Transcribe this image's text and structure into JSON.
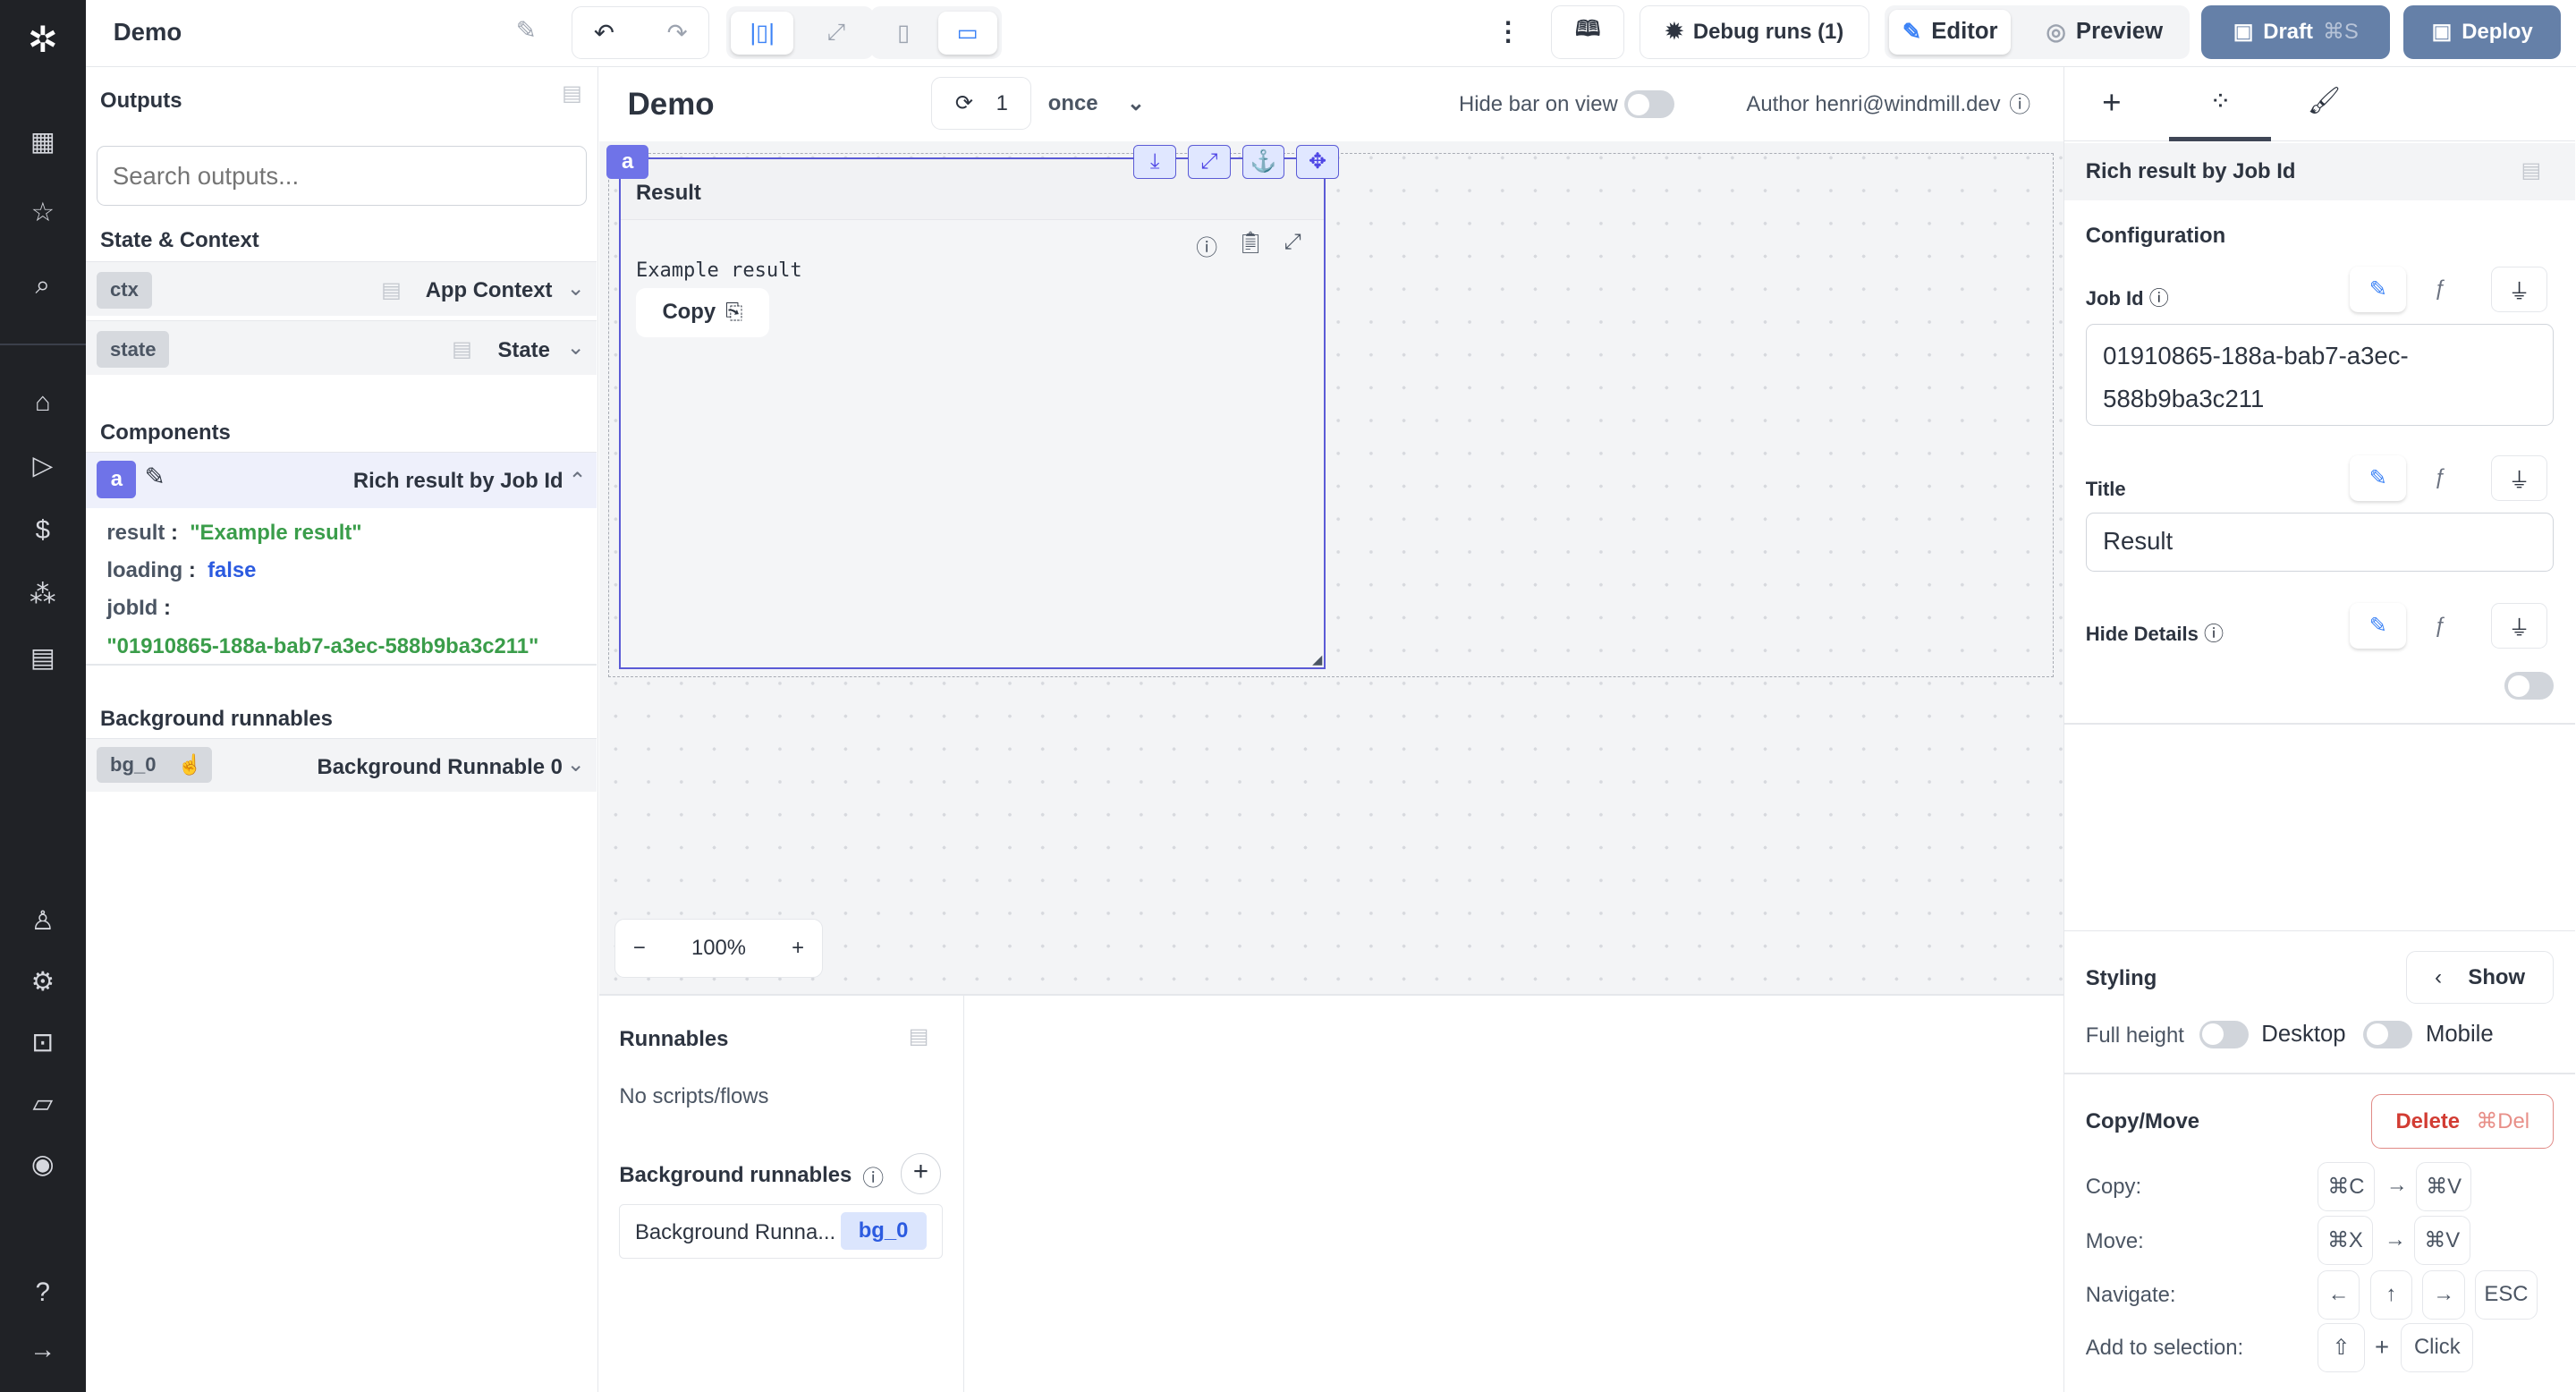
{
  "app": {
    "title": "Demo"
  },
  "toolbar": {
    "debug_runs": "Debug runs (1)",
    "editor": "Editor",
    "preview": "Preview",
    "draft": "Draft",
    "draft_shortcut": "⌘S",
    "deploy": "Deploy",
    "accent": "#3b82f6",
    "primary_bg": "#6580a8"
  },
  "outputs": {
    "title": "Outputs",
    "search_placeholder": "Search outputs...",
    "state_title": "State & Context",
    "ctx_tag": "ctx",
    "ctx_label": "App Context",
    "state_tag": "state",
    "state_label": "State",
    "components_title": "Components",
    "component_id": "a",
    "component_label": "Rich result by Job Id",
    "fields": [
      {
        "key": "result",
        "value": "\"Example result\""
      },
      {
        "key": "loading",
        "value": "false"
      },
      {
        "key": "jobId",
        "value": "\"01910865-188a-bab7-a3ec-588b9ba3c211\""
      }
    ],
    "bg_title": "Background runnables",
    "bg_tag": "bg_0",
    "bg_label": "Background Runnable 0"
  },
  "canvas": {
    "title": "Demo",
    "refresh_count": "1",
    "refresh_mode": "once",
    "hide_bar": "Hide bar on view",
    "author": "Author henri@windmill.dev",
    "component": {
      "id": "a",
      "header": "Result",
      "content": "Example result",
      "copy": "Copy"
    },
    "zoom": "100%"
  },
  "runnables": {
    "title": "Runnables",
    "empty": "No scripts/flows",
    "bg_title": "Background runnables",
    "bg_item": "Background Runna...",
    "bg_item_tag": "bg_0"
  },
  "settings": {
    "title": "Rich result by Job Id",
    "config": "Configuration",
    "job_id_label": "Job Id",
    "job_id_value": "01910865-188a-bab7-a3ec-588b9ba3c211",
    "title_label": "Title",
    "title_value": "Result",
    "hide_details": "Hide Details",
    "hide_details_on": false,
    "styling": "Styling",
    "show": "Show",
    "full_height": "Full height",
    "desktop": "Desktop",
    "mobile": "Mobile",
    "copy_move": "Copy/Move",
    "delete": "Delete",
    "delete_shortcut": "⌘Del",
    "shortcuts": [
      {
        "label": "Copy:",
        "keys": [
          "⌘C",
          "⌘V"
        ]
      },
      {
        "label": "Move:",
        "keys": [
          "⌘X",
          "⌘V"
        ]
      },
      {
        "label": "Navigate:",
        "keys": [
          "←",
          "↑",
          "→",
          "ESC"
        ]
      },
      {
        "label": "Add to selection:",
        "keys": [
          "⇧",
          "Click"
        ]
      }
    ]
  }
}
